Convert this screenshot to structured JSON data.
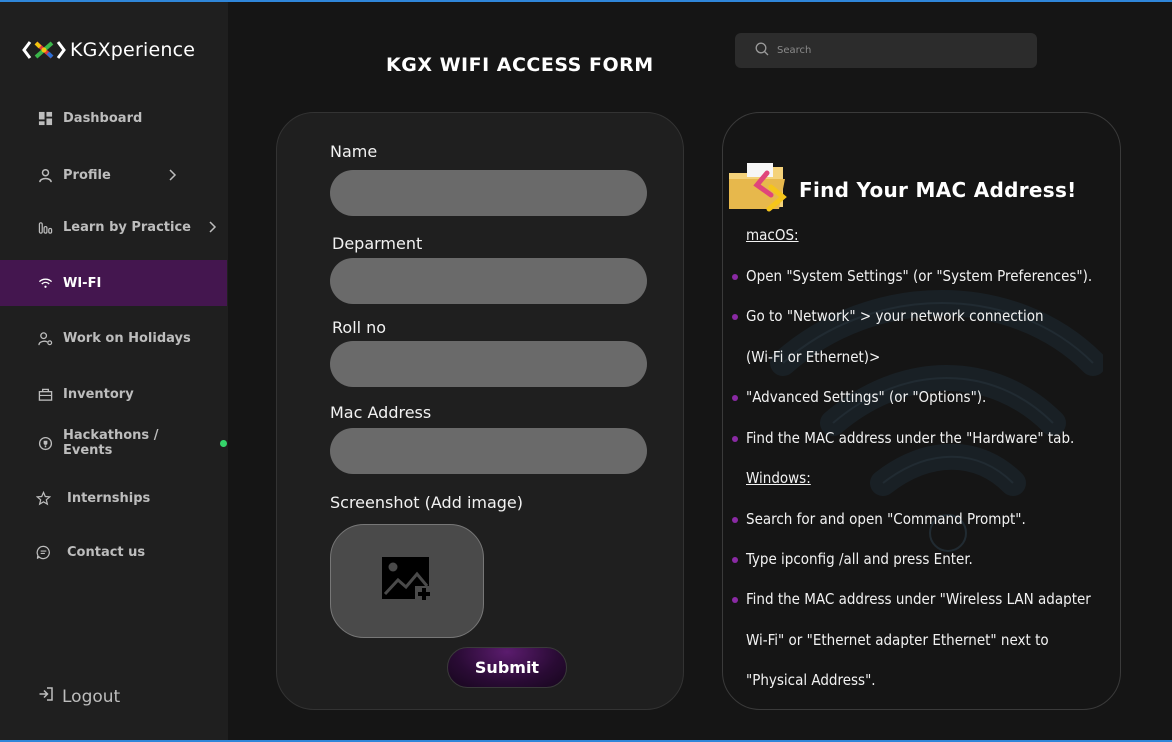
{
  "brand": {
    "name": "KGXperience"
  },
  "sidebar": {
    "items": [
      {
        "label": "Dashboard",
        "icon": "dashboard-icon"
      },
      {
        "label": "Profile",
        "icon": "user-icon"
      },
      {
        "label": "Learn by Practice",
        "icon": "chart-bars-icon"
      },
      {
        "label": "WI-FI",
        "icon": "wifi-icon",
        "active": true
      },
      {
        "label": "Work on Holidays",
        "icon": "user-settings-icon"
      },
      {
        "label": "Inventory",
        "icon": "box-icon"
      },
      {
        "label": "Hackathons / Events",
        "icon": "trophy-icon",
        "status": "online"
      },
      {
        "label": "Internships",
        "icon": "star-icon"
      },
      {
        "label": "Contact us",
        "icon": "message-icon"
      }
    ],
    "logout_label": "Logout"
  },
  "header": {
    "title": "KGX WIFI ACCESS FORM",
    "search_placeholder": "Search"
  },
  "form": {
    "fields": [
      {
        "label": "Name",
        "value": ""
      },
      {
        "label": "Deparment",
        "value": ""
      },
      {
        "label": "Roll no",
        "value": ""
      },
      {
        "label": "Mac Address",
        "value": ""
      }
    ],
    "screenshot_label": "Screenshot  (Add image)",
    "submit_label": "Submit"
  },
  "info": {
    "title": "Find Your MAC Address!",
    "macos_heading": "macOS:",
    "mac_steps": [
      "Open \"System Settings\" (or \"System Preferences\").",
      "Go to \"Network\" > your network connection",
      "(Wi-Fi or Ethernet)>",
      "\"Advanced Settings\" (or \"Options\").",
      "Find the MAC address under the \"Hardware\" tab."
    ],
    "windows_heading": "Windows:",
    "windows_steps": [
      "Search for and open \"Command Prompt\".",
      "Type ipconfig /all and press Enter.",
      "Find the MAC address under \"Wireless LAN adapter",
      " Wi-Fi\" or \"Ethernet adapter Ethernet\" next to",
      "\"Physical Address\"."
    ]
  },
  "colors": {
    "accent": "#44164f",
    "bullet": "#8a2aa4",
    "online": "#35d46a",
    "frame": "#2f86d9"
  }
}
